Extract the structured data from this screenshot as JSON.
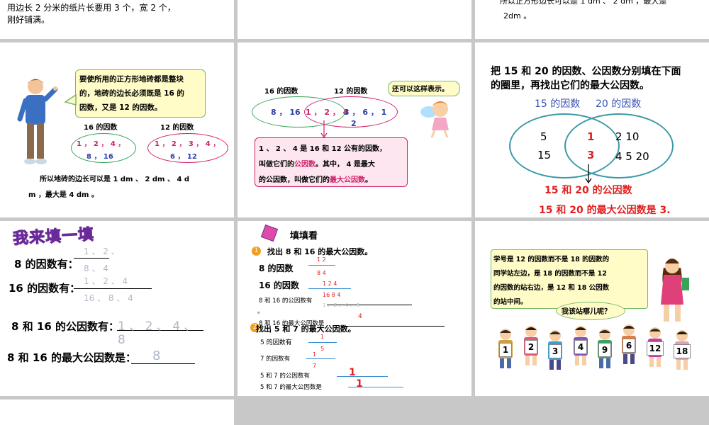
{
  "slide1": {
    "line1": "用边长 2 分米的纸片长要用 3 个，宽 2 个，",
    "line2": "刚好铺满。"
  },
  "slide3": {
    "line1": "所以正方形边长可以是 1 dm 、 2 dm ，最大是",
    "line2": "2dm 。"
  },
  "slide4": {
    "bubble": [
      "要使所用的正方形地砖都是整块",
      "的，地砖的边长必须既是 16 的",
      "因数，又是 12 的因数。"
    ],
    "label_16": "16 的因数",
    "label_12": "12 的因数",
    "set16": [
      "1 ， 2 ， 4 ，",
      "8 ， 16"
    ],
    "set12": [
      "1 ， 2 ， 3 ， 4 ，",
      "6 ， 12"
    ],
    "conclusion1": "所以地砖的边长可以是 1 dm 、 2 dm 、 4 d",
    "conclusion2": "m ，最大是 4 dm 。"
  },
  "slide5": {
    "label_16": "16 的因数",
    "label_12": "12 的因数",
    "bubble": "还可以这样表示。",
    "left_only": "8 ， 16",
    "common": "1 ， 2 ， 4",
    "right_only": "3 ， 6 ， 1",
    "right_only2": "2",
    "box": [
      "1 、 2 、 4 是 16 和 12 公有的因数，",
      "叫做它们的",
      "公因数",
      "。其中， 4 是最大",
      "的公因数，叫做它们的",
      "最大公因数",
      "。"
    ]
  },
  "slide6": {
    "prompt1": "把 15 和 20 的因数、公因数分别填在下面",
    "prompt2": "的圈里，再找出它们的最大公因数。",
    "label_15": "15 的因数",
    "label_20": "20 的因数",
    "left": [
      "5",
      "15"
    ],
    "common": [
      "1",
      "3"
    ],
    "right": [
      "2  10",
      "4   5   20"
    ],
    "common_label": "15 和 20 的公因数",
    "answer": "15 和 20 的最大公因数是 3."
  },
  "slide7": {
    "title": "我来填一填",
    "q1": "8 的因数有：",
    "a1": [
      "1 、 2 、",
      "8 、 4"
    ],
    "q2": "16 的因数有：",
    "a2": [
      "1 、 2 、 4",
      "16 、 8 、 4"
    ],
    "q3": "8 和 16 的公因数有：",
    "a3": [
      "1 、 2 、 4 、",
      "8"
    ],
    "q4": "8 和 16 的最大公因数是：",
    "a4": "8"
  },
  "slide8": {
    "title": "填填看",
    "item1_num": "1",
    "item1": "找出 8 和 16 的最大公因数。",
    "f8_label": "8 的因数",
    "f8_vals": [
      "1   2",
      "8   4"
    ],
    "f16_label": "16 的因数",
    "f16_vals": [
      "1   2   4",
      "16   8   4"
    ],
    "common_label": "8 和 16 的公因数有",
    "common_vals": "1 、 2 、 4 、 8",
    "dot": "。",
    "max_label": "8 和 16 的最大公因数是",
    "max_val": "4",
    "item2_num": "2",
    "item2": "找出 5 和 7 的最大公因数。",
    "f5_label": "5 的因数有",
    "f5_vals": [
      "1",
      "5"
    ],
    "f7_label": "7 的因数有",
    "f7_vals": [
      "1",
      "7"
    ],
    "c57_label": "5 和 7 的公因数有",
    "c57_val": "1",
    "m57_label": "5 和 7 的最大公因数是",
    "m57_val": "1"
  },
  "slide9": {
    "box": [
      "学号是 12 的因数而不是 18 的因数的",
      "同学站左边，是 18 的因数而不是 12",
      "的因数的站右边，是 12 和 18 公因数",
      "的站中间。"
    ],
    "bubble": "我该站哪儿呢？",
    "cards": [
      "1",
      "2",
      "3",
      "4",
      "9",
      "6",
      "12",
      "18"
    ]
  },
  "colors": {
    "blue": "#2b3fa8",
    "pink": "#d0206a",
    "red": "#e02020",
    "teal": "#3a9aa6",
    "green": "#2a8a3a"
  }
}
